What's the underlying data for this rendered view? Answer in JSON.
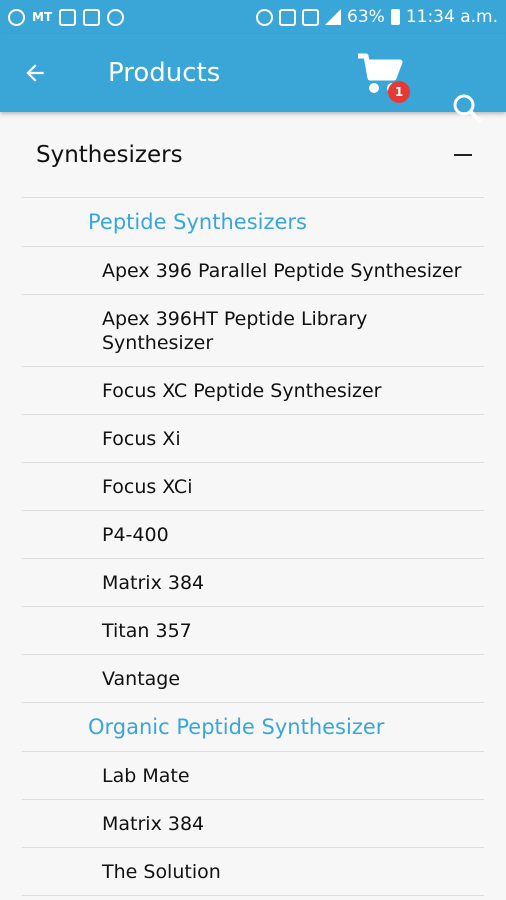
{
  "status_bar": {
    "carrier_text": "MT",
    "battery_percent": "63%",
    "time": "11:34 a.m."
  },
  "app_bar": {
    "title": "Products",
    "cart_badge": "1"
  },
  "category": {
    "label": "Synthesizers",
    "subcategories": [
      {
        "label": "Peptide Synthesizers",
        "items": [
          "Apex 396 Parallel Peptide Synthesizer",
          "Apex 396HT Peptide Library Synthesizer",
          "Focus XC Peptide Synthesizer",
          "Focus Xi",
          "Focus XCi",
          "P4-400",
          "Matrix 384",
          "Titan 357",
          "Vantage"
        ]
      },
      {
        "label": "Organic Peptide Synthesizer",
        "items": [
          "Lab Mate",
          "Matrix 384",
          "The Solution"
        ]
      }
    ]
  },
  "colors": {
    "primary": "#3aa6d8",
    "badge": "#e53935"
  }
}
